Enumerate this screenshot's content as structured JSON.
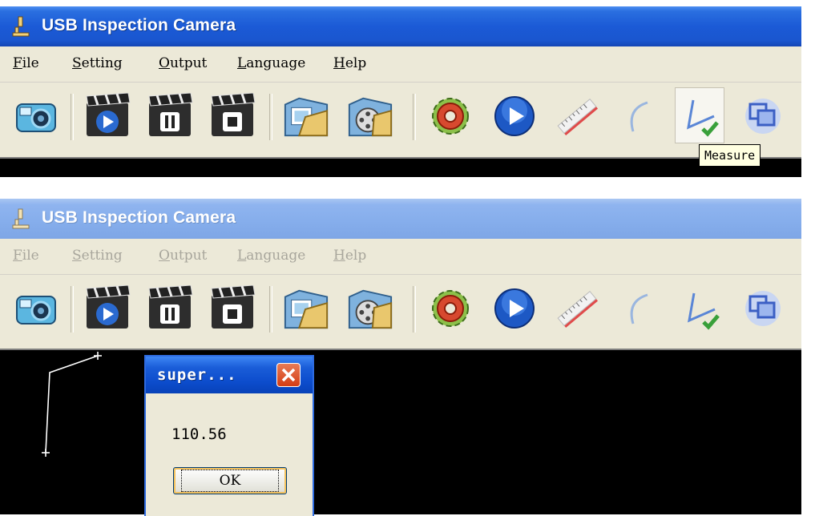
{
  "window_title": "USB Inspection Camera",
  "menu": [
    {
      "label": "File",
      "key": "F",
      "rest": "ile"
    },
    {
      "label": "Setting",
      "key": "S",
      "rest": "etting"
    },
    {
      "label": "Output",
      "key": "O",
      "rest": "utput"
    },
    {
      "label": "Language",
      "key": "L",
      "rest": "anguage"
    },
    {
      "label": "Help",
      "key": "H",
      "rest": "elp"
    }
  ],
  "toolbar_icons": [
    "camera-snapshot-icon",
    "record-play-icon",
    "record-pause-icon",
    "record-stop-icon",
    "open-photo-folder-icon",
    "open-video-folder-icon",
    "settings-gear-icon",
    "play-icon",
    "ruler-line-icon",
    "arc-measure-icon",
    "measure-angle-icon",
    "overlay-window-icon"
  ],
  "tooltip": "Measure",
  "dialog": {
    "title": "super...",
    "message": "110.56",
    "ok_label": "OK"
  },
  "colors": {
    "titlebar_active": "#1b5ad6",
    "titlebar_inactive": "#86aeec",
    "window_face": "#ece9d8",
    "video_bg": "#000000",
    "close_button": "#d43d14"
  }
}
